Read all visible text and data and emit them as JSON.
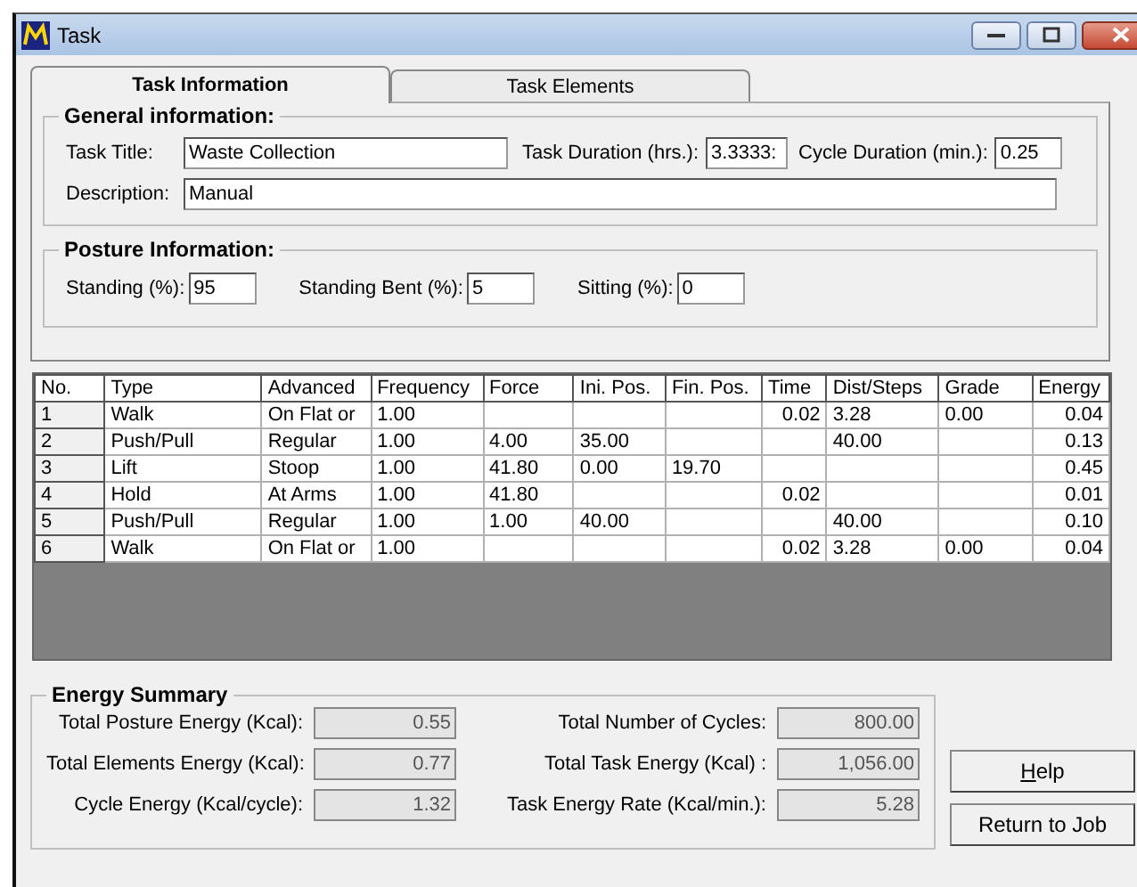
{
  "window": {
    "title": "Task"
  },
  "tabs": [
    {
      "label": "Task Information",
      "selected": true
    },
    {
      "label": "Task Elements",
      "selected": false
    }
  ],
  "general": {
    "title": "General information:",
    "task_title_label": "Task Title:",
    "task_title": "Waste Collection",
    "duration_label": "Task Duration (hrs.):",
    "duration": "3.3333:",
    "cycle_label": "Cycle Duration (min.):",
    "cycle": "0.25",
    "description_label": "Description:",
    "description": "Manual"
  },
  "posture": {
    "title": "Posture Information:",
    "fields": [
      {
        "label": "Standing (%):",
        "value": "95"
      },
      {
        "label": "Standing Bent (%):",
        "value": "5"
      },
      {
        "label": "Sitting (%):",
        "value": "0"
      }
    ]
  },
  "table": {
    "columns": [
      "No.",
      "Type",
      "Advanced",
      "Frequency",
      "Force",
      "Ini. Pos.",
      "Fin. Pos.",
      "Time",
      "Dist/Steps",
      "Grade",
      "Energy"
    ],
    "rows": [
      [
        "1",
        "Walk",
        "On Flat or",
        "1.00",
        "",
        "",
        "",
        "0.02",
        "3.28",
        "0.00",
        "0.04"
      ],
      [
        "2",
        "Push/Pull",
        "Regular",
        "1.00",
        "4.00",
        "35.00",
        "",
        "",
        "40.00",
        "",
        "0.13"
      ],
      [
        "3",
        "Lift",
        "Stoop",
        "1.00",
        "41.80",
        "0.00",
        "19.70",
        "",
        "",
        "",
        "0.45"
      ],
      [
        "4",
        "Hold",
        "At Arms",
        "1.00",
        "41.80",
        "",
        "",
        "0.02",
        "",
        "",
        "0.01"
      ],
      [
        "5",
        "Push/Pull",
        "Regular",
        "1.00",
        "1.00",
        "40.00",
        "",
        "",
        "40.00",
        "",
        "0.10"
      ],
      [
        "6",
        "Walk",
        "On Flat or",
        "1.00",
        "",
        "",
        "",
        "0.02",
        "3.28",
        "0.00",
        "0.04"
      ]
    ]
  },
  "energy_summary": {
    "title": "Energy Summary",
    "fields": [
      {
        "label": "Total Posture Energy (Kcal):",
        "value": "0.55"
      },
      {
        "label": "Total Number of Cycles:",
        "value": "800.00"
      },
      {
        "label": "Total Elements Energy (Kcal):",
        "value": "0.77"
      },
      {
        "label": "Total Task Energy (Kcal) :",
        "value": "1,056.00"
      },
      {
        "label": "Cycle Energy (Kcal/cycle):",
        "value": "1.32"
      },
      {
        "label": "Task Energy Rate (Kcal/min.):",
        "value": "5.28"
      }
    ]
  },
  "buttons": [
    "Help",
    "Return to Job"
  ]
}
